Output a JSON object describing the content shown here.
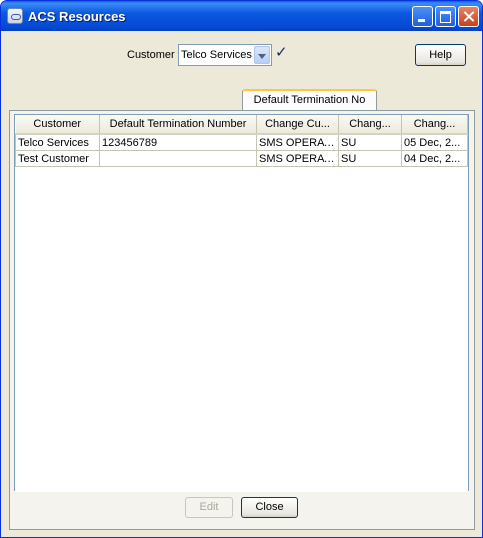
{
  "window": {
    "title": "ACS Resources"
  },
  "toolbar": {
    "customer_label": "Customer",
    "customer_value": "Telco Services",
    "help_label": "Help"
  },
  "tabs": [
    {
      "label": "Default Termination No",
      "selected": true
    }
  ],
  "table": {
    "columns": [
      "Customer",
      "Default Termination Number",
      "Change Cu...",
      "Chang...",
      "Chang..."
    ],
    "rows": [
      [
        "Telco Services",
        "123456789",
        "SMS OPERATOR",
        "SU",
        "05 Dec, 2..."
      ],
      [
        "Test Customer",
        "",
        "SMS OPERATOR",
        "SU",
        "04 Dec, 2..."
      ]
    ]
  },
  "buttons": {
    "edit_label": "Edit",
    "edit_enabled": false,
    "close_label": "Close"
  },
  "icons": {
    "app": "acs-app-icon",
    "apply": "checkmark-icon"
  },
  "colors": {
    "titlebar": "#0a5ae0",
    "window_bg": "#ece9d8",
    "tab_accent": "#ffc83c"
  }
}
